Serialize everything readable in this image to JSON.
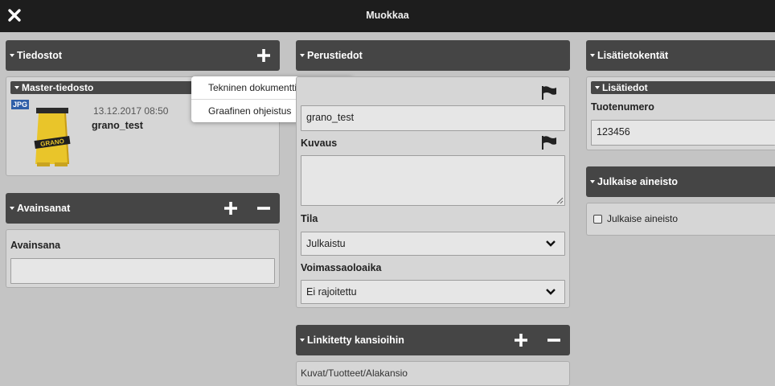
{
  "window": {
    "title": "Muokkaa"
  },
  "files": {
    "header": "Tiedostot",
    "master_header": "Master-tiedosto",
    "item": {
      "type_badge": "JPG",
      "date": "13.12.2017 08:50",
      "name": "grano_test",
      "image_text": "GRANO"
    },
    "add_menu": [
      "Tekninen dokumentti",
      "Graafinen ohjeistus"
    ]
  },
  "keywords": {
    "header": "Avainsanat",
    "field_label": "Avainsana",
    "value": ""
  },
  "basic": {
    "header": "Perustiedot",
    "name_value": "grano_test",
    "description_label": "Kuvaus",
    "description_value": "",
    "status_label": "Tila",
    "status_value": "Julkaistu",
    "validity_label": "Voimassaoloaika",
    "validity_value": "Ei rajoitettu"
  },
  "linked": {
    "header": "Linkitetty kansioihin",
    "path": "Kuvat/Tuotteet/Alakansio"
  },
  "extra": {
    "header": "Lisätietokentät",
    "sub_header": "Lisätiedot",
    "product_number_label": "Tuotenumero",
    "product_number_value": "123456"
  },
  "publish": {
    "header": "Julkaise aineisto",
    "checkbox_label": "Julkaise aineisto",
    "checked": false
  },
  "colors": {
    "topbar": "#1d1d1d",
    "header": "#454545",
    "background": "#c4c4c4",
    "panel": "#d6d6d6",
    "badge": "#2f5fa8"
  }
}
